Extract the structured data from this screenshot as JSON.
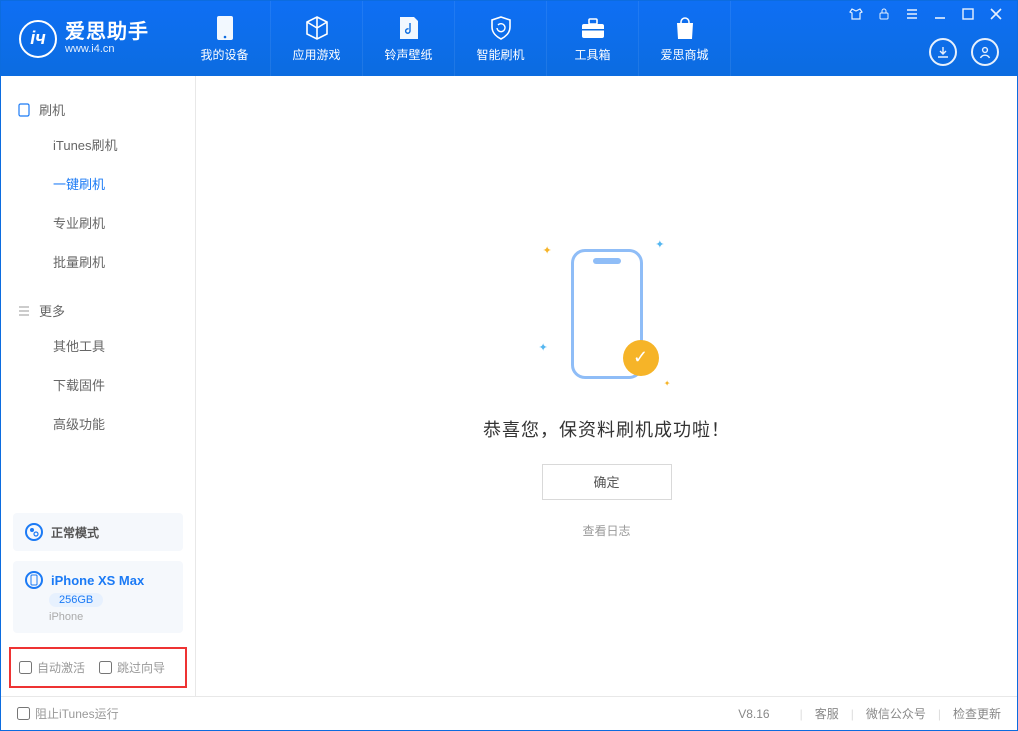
{
  "header": {
    "app_title": "爱思助手",
    "app_sub": "www.i4.cn",
    "tabs": [
      {
        "label": "我的设备"
      },
      {
        "label": "应用游戏"
      },
      {
        "label": "铃声壁纸"
      },
      {
        "label": "智能刷机"
      },
      {
        "label": "工具箱"
      },
      {
        "label": "爱思商城"
      }
    ]
  },
  "sidebar": {
    "group1_title": "刷机",
    "group1_items": [
      "iTunes刷机",
      "一键刷机",
      "专业刷机",
      "批量刷机"
    ],
    "group1_active_index": 1,
    "group2_title": "更多",
    "group2_items": [
      "其他工具",
      "下载固件",
      "高级功能"
    ],
    "mode_label": "正常模式",
    "device_name": "iPhone XS Max",
    "device_capacity": "256GB",
    "device_type": "iPhone",
    "opt_auto_activate": "自动激活",
    "opt_skip_guide": "跳过向导"
  },
  "main": {
    "success_message": "恭喜您，保资料刷机成功啦！",
    "ok_label": "确定",
    "log_label": "查看日志"
  },
  "footer": {
    "block_itunes": "阻止iTunes运行",
    "version": "V8.16",
    "support": "客服",
    "wechat": "微信公众号",
    "update": "检查更新"
  }
}
